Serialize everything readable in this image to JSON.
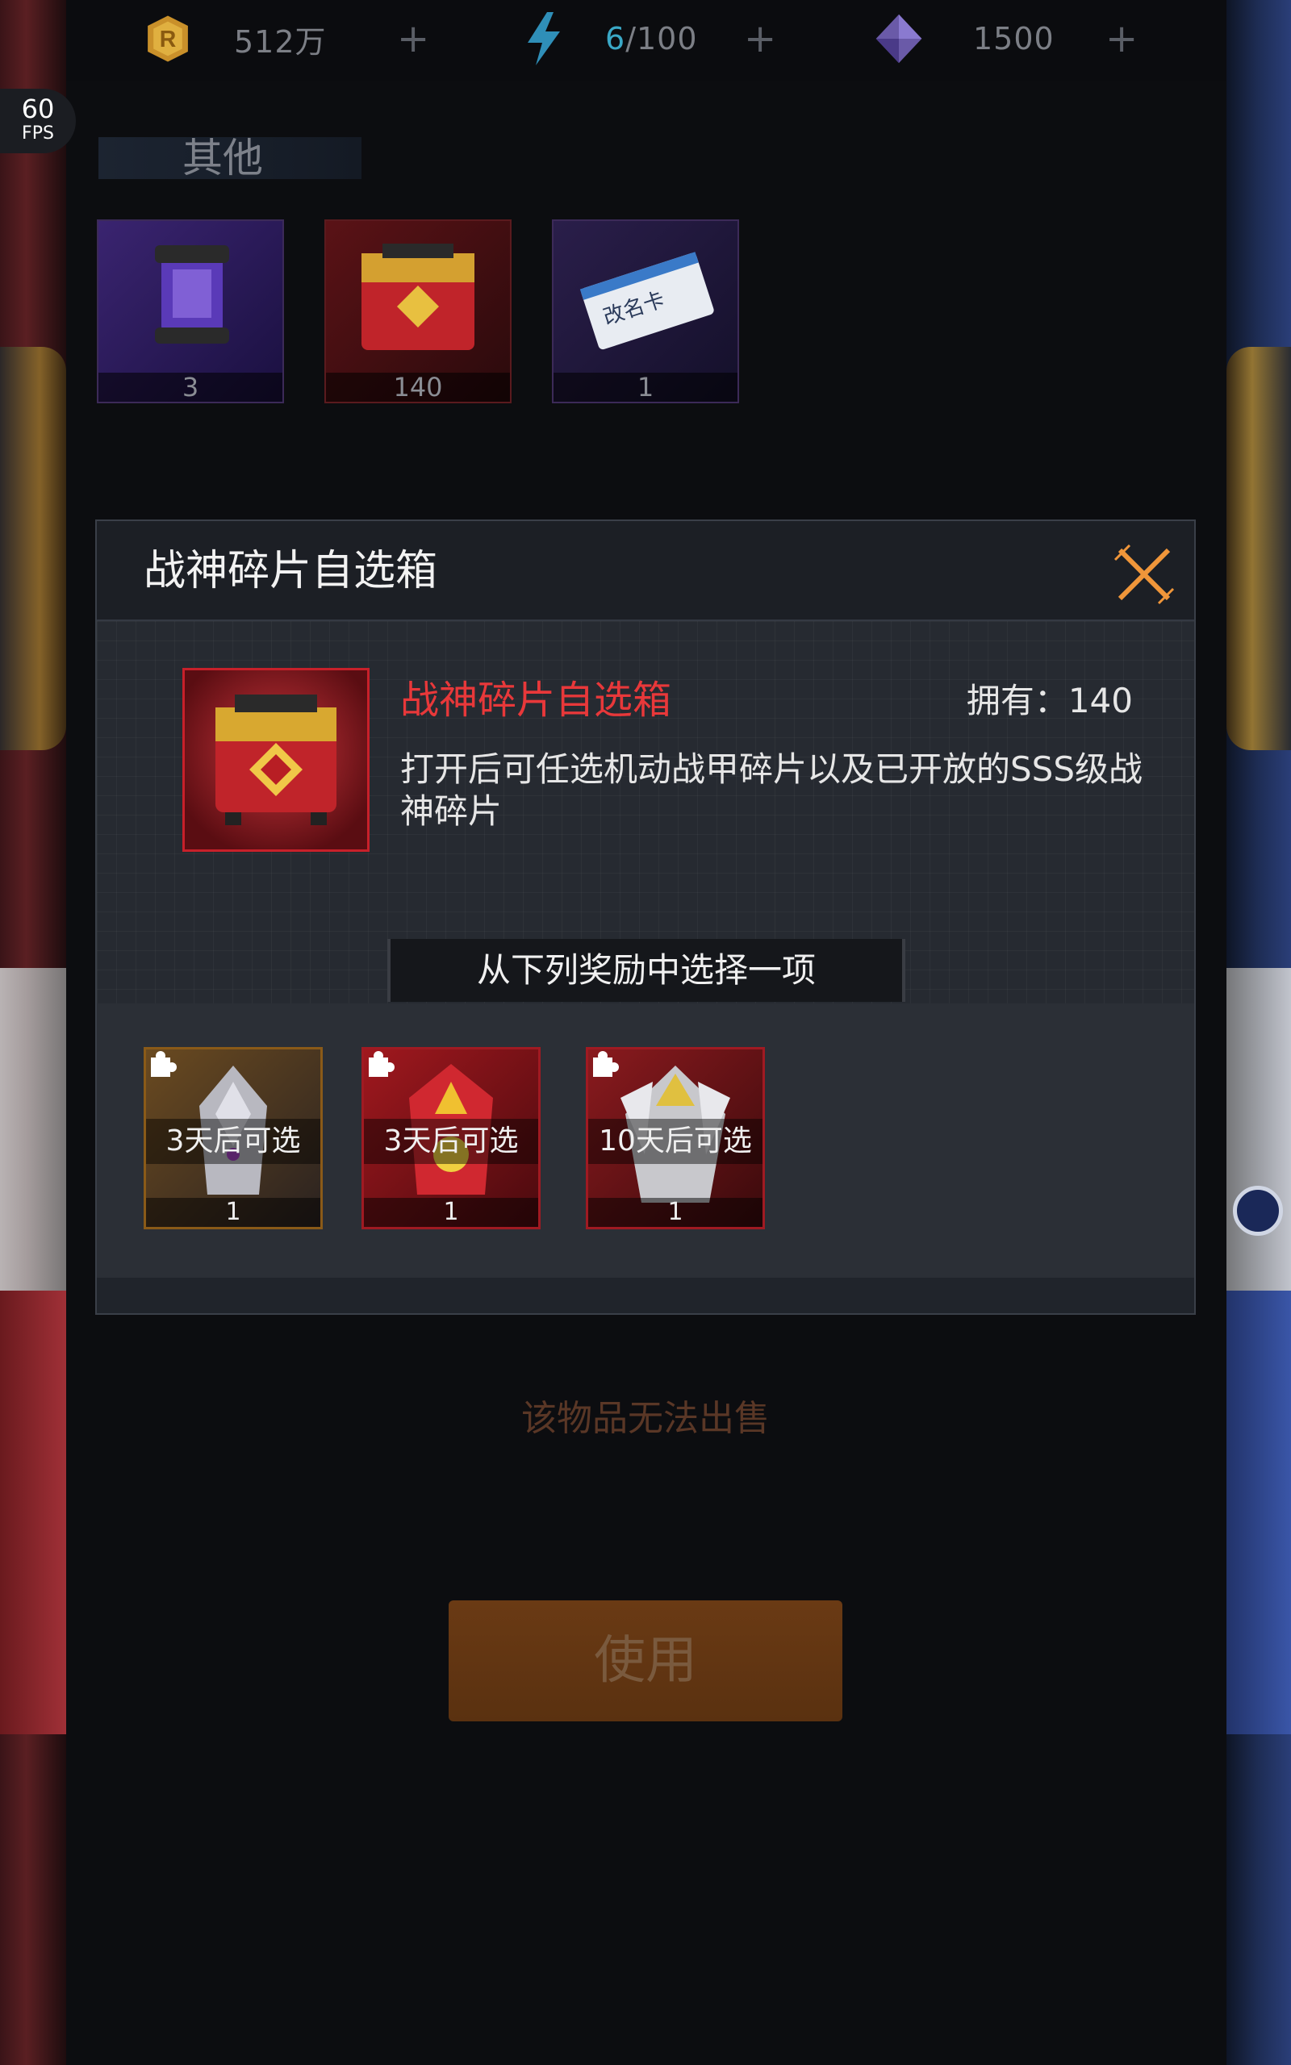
{
  "topbar": {
    "coins": {
      "icon": "r-coin-icon",
      "value": "512万"
    },
    "energy": {
      "icon": "lightning-icon",
      "current": "6",
      "max": "/100"
    },
    "gems": {
      "icon": "crystal-icon",
      "value": "1500"
    },
    "plus_label": "+"
  },
  "fps": {
    "value": "60",
    "label": "FPS"
  },
  "category": {
    "title": "其他"
  },
  "inventory": [
    {
      "name": "energy-canister",
      "qty": "3"
    },
    {
      "name": "war-god-fragment-box",
      "qty": "140"
    },
    {
      "name": "rename-card",
      "qty": "1",
      "card_text": "改名卡"
    }
  ],
  "modal": {
    "title": "战神碎片自选箱",
    "item_name": "战神碎片自选箱",
    "owned": "拥有：140",
    "description": "打开后可任选机动战甲碎片以及已开放的SSS级战神碎片",
    "choose_prompt": "从下列奖励中选择一项",
    "rewards": [
      {
        "timer": "3天后可选",
        "qty": "1"
      },
      {
        "timer": "3天后可选",
        "qty": "1"
      },
      {
        "timer": "10天后可选",
        "qty": "1"
      }
    ]
  },
  "footer": {
    "no_sell": "该物品无法出售",
    "use_button": "使用"
  },
  "colors": {
    "accent_red": "#e8383a",
    "close_orange": "#f0963a",
    "energy_blue": "#3aa8c6"
  }
}
